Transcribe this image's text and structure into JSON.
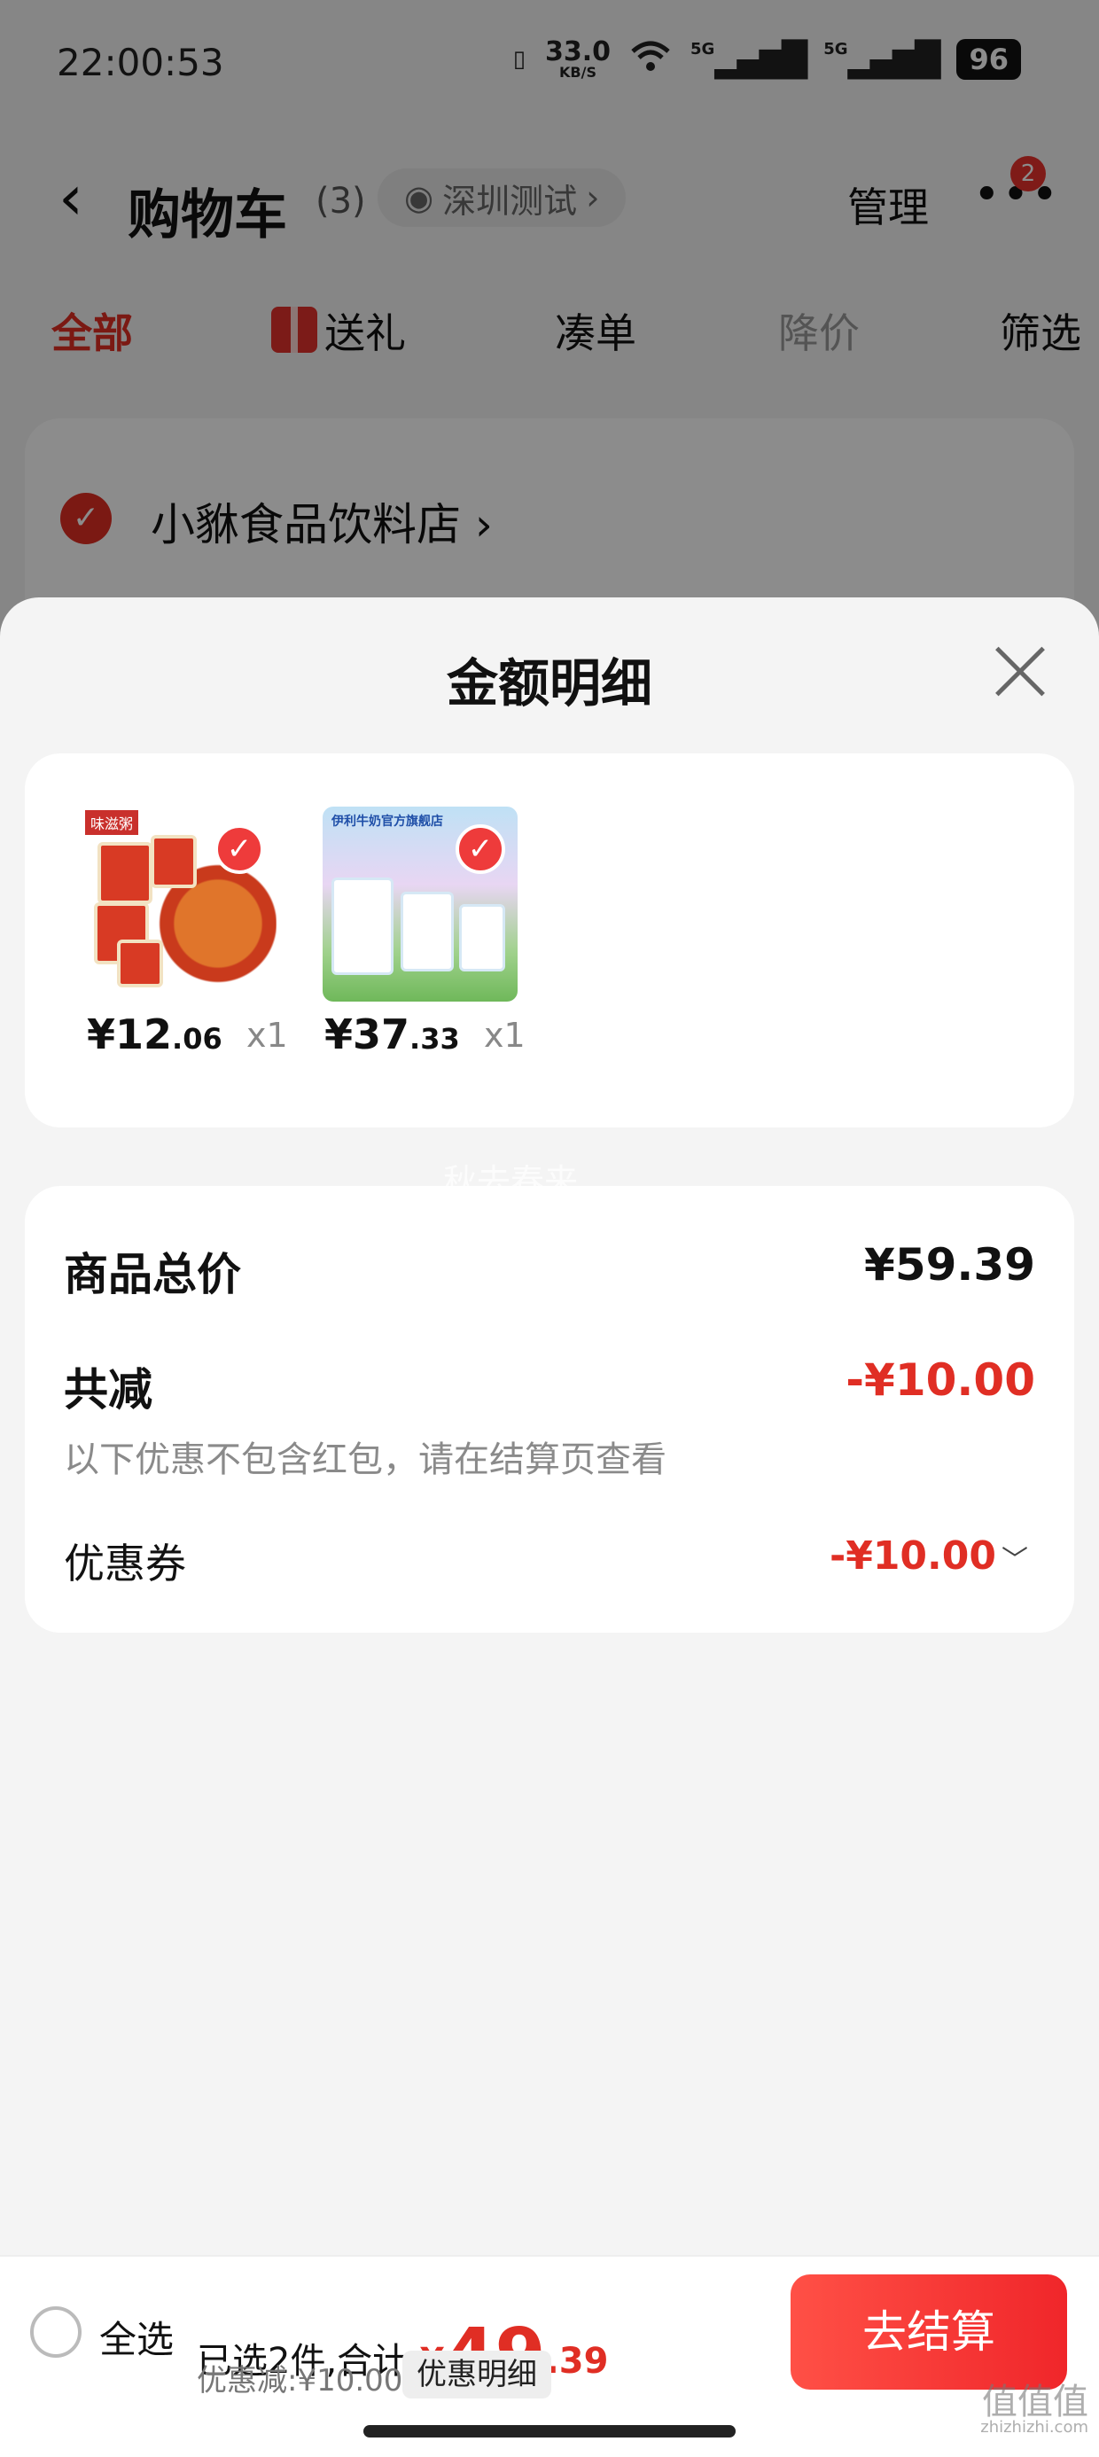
{
  "status_bar": {
    "time": "22:00:53",
    "speed_value": "33.0",
    "speed_unit": "KB/S",
    "sim1": "5G",
    "sim2": "5G",
    "battery": "96"
  },
  "nav": {
    "title": "购物车",
    "count": "(3)",
    "location": "深圳测试",
    "manage": "管理",
    "badge": "2"
  },
  "tabs": [
    {
      "label": "全部"
    },
    {
      "label": "送礼"
    },
    {
      "label": "凑单"
    },
    {
      "label": "降价"
    },
    {
      "label": "筛选"
    }
  ],
  "shop": {
    "name": "小貅食品饮料店"
  },
  "sheet": {
    "title": "金额明细",
    "goods": [
      {
        "price_int": "¥12",
        "price_dec": ".06",
        "qty": "x1",
        "thumb_text": "味滋粥"
      },
      {
        "price_int": "¥37",
        "price_dec": ".33",
        "qty": "x1",
        "thumb_text": "伊利牛奶官方旗舰店"
      }
    ],
    "watermark": "秋去春来",
    "summary": {
      "total_label": "商品总价",
      "total_value": "¥59.39",
      "reduce_label": "共减",
      "reduce_value": "-¥10.00",
      "note": "以下优惠不包含红包，请在结算页查看",
      "coupon_label": "优惠券",
      "coupon_value": "-¥10.00"
    }
  },
  "bottom": {
    "select_all": "全选",
    "selected_prefix": "已选2件,合计:",
    "total_symbol": "¥",
    "total_int": "49",
    "total_dec": ".39",
    "discount": "优惠减:¥10.00",
    "discount_detail": "优惠明细",
    "checkout": "去结算"
  },
  "corner_mark": {
    "big": "值值值",
    "small": "zhizhizhi.com"
  },
  "colors": {
    "accent": "#e02e24",
    "checkout": "#f0262a"
  }
}
